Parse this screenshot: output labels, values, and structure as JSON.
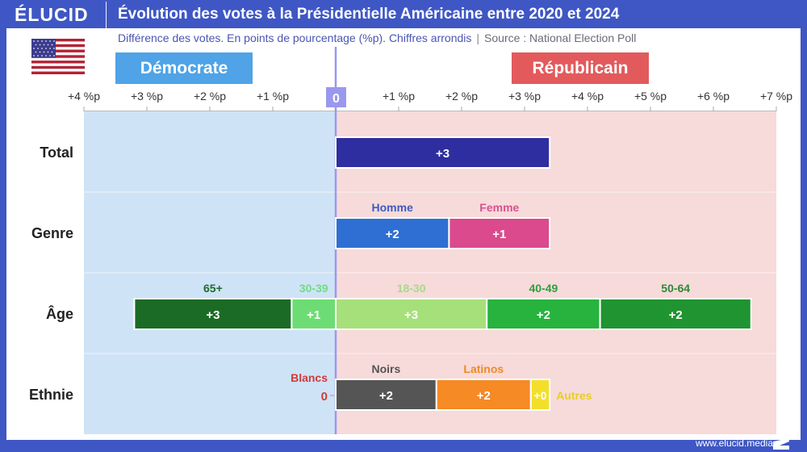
{
  "header": {
    "brand": "ÉLUCID",
    "title": "Évolution des votes à la Présidentielle Américaine entre 2020 et 2024",
    "subtitle": "Différence des votes. En points de pourcentage (%p). Chiffres arrondis",
    "separator": "|",
    "source": "Source : National Election Poll"
  },
  "flag_icon": "us-flag-icon",
  "footer": {
    "url": "www.elucid.media"
  },
  "colors": {
    "frame": "#3f57c4",
    "dem_bg": "#cfe3f6",
    "rep_bg": "#f7dada",
    "dem_label": "#4fa3e6",
    "rep_label": "#e25a5c",
    "zero_line": "#9a98ee"
  },
  "chart_data": {
    "type": "bar",
    "orientation": "horizontal-stacked-diverging",
    "title": "Évolution des votes à la Présidentielle Américaine entre 2020 et 2024",
    "subtitle": "Différence des votes. En points de pourcentage (%p). Chiffres arrondis",
    "left_label": "Démocrate",
    "right_label": "Républicain",
    "zero_label": "0",
    "xlim": [
      -4,
      7
    ],
    "x_ticks": [
      {
        "value": -4,
        "label": "+4 %p"
      },
      {
        "value": -3,
        "label": "+3 %p"
      },
      {
        "value": -2,
        "label": "+2 %p"
      },
      {
        "value": -1,
        "label": "+1 %p"
      },
      {
        "value": 1,
        "label": "+1 %p"
      },
      {
        "value": 2,
        "label": "+2 %p"
      },
      {
        "value": 3,
        "label": "+3 %p"
      },
      {
        "value": 4,
        "label": "+4 %p"
      },
      {
        "value": 5,
        "label": "+5 %p"
      },
      {
        "value": 6,
        "label": "+6 %p"
      },
      {
        "value": 7,
        "label": "+7 %p"
      }
    ],
    "grid": false,
    "rows": [
      {
        "label": "Total",
        "segments": [
          {
            "name": "",
            "side": "rep",
            "value": 3.4,
            "label": "+3",
            "color": "#2e2ea0",
            "cat_color": ""
          }
        ]
      },
      {
        "label": "Genre",
        "segments": [
          {
            "name": "Homme",
            "side": "rep",
            "value": 1.8,
            "label": "+2",
            "color": "#2f6fd4",
            "cat_color": "#3b5cc0"
          },
          {
            "name": "Femme",
            "side": "rep",
            "value": 1.6,
            "label": "+1",
            "color": "#db4a8c",
            "cat_color": "#d9508e"
          }
        ]
      },
      {
        "label": "Âge",
        "segments": [
          {
            "name": "65+",
            "side": "dem",
            "value": 2.5,
            "label": "+3",
            "color": "#1b6b26",
            "cat_color": "#1f6b2c"
          },
          {
            "name": "30-39",
            "side": "dem",
            "value": 0.7,
            "label": "+1",
            "color": "#6ddc74",
            "cat_color": "#6ddc84"
          },
          {
            "name": "18-30",
            "side": "rep",
            "value": 2.4,
            "label": "+3",
            "color": "#a6e07a",
            "cat_color": "#a7d98a"
          },
          {
            "name": "40-49",
            "side": "rep",
            "value": 1.8,
            "label": "+2",
            "color": "#27b33e",
            "cat_color": "#2e9e3f"
          },
          {
            "name": "50-64",
            "side": "rep",
            "value": 2.4,
            "label": "+2",
            "color": "#1f9431",
            "cat_color": "#2c8a36"
          }
        ]
      },
      {
        "label": "Ethnie",
        "zero_item": {
          "name": "Blancs",
          "label": "0",
          "color": "#d23a3a"
        },
        "segments": [
          {
            "name": "Noirs",
            "side": "rep",
            "value": 1.6,
            "label": "+2",
            "color": "#555555",
            "cat_color": "#555555"
          },
          {
            "name": "Latinos",
            "side": "rep",
            "value": 1.5,
            "label": "+2",
            "color": "#f68a25",
            "cat_color": "#ef8a22"
          },
          {
            "name": "Autres",
            "side": "rep",
            "value": 0.3,
            "label": "+0",
            "color": "#f3df2a",
            "cat_color": "#e6cf25",
            "label_outside": true
          }
        ]
      }
    ]
  }
}
